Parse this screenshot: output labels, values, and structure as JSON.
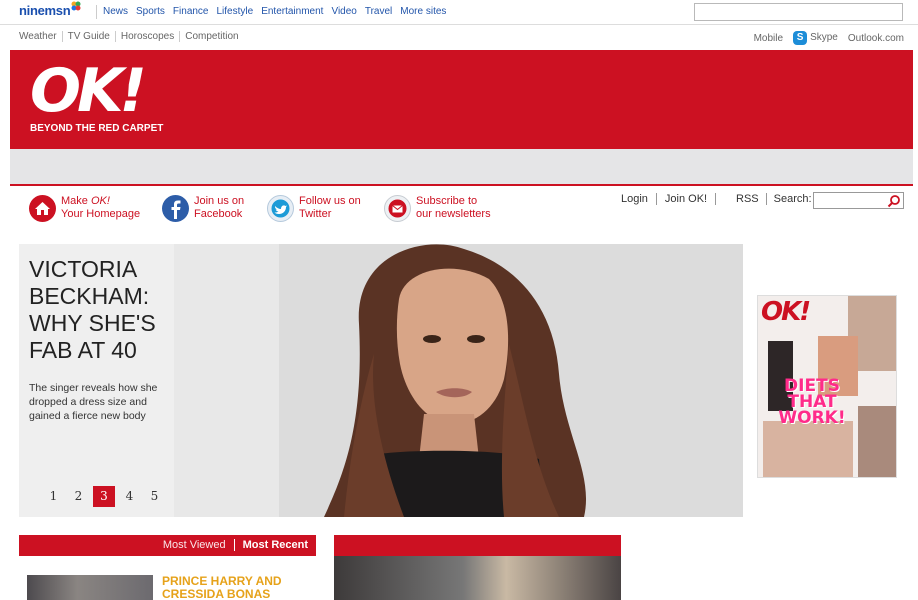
{
  "msn": {
    "logo": "ninemsn",
    "nav": [
      "News",
      "Sports",
      "Finance",
      "Lifestyle",
      "Entertainment",
      "Video",
      "Travel",
      "More sites"
    ],
    "search_placeholder": ""
  },
  "subnav": {
    "items": [
      "Weather",
      "TV Guide",
      "Horoscopes",
      "Competition"
    ],
    "right": {
      "mobile": "Mobile",
      "skype": "Skype",
      "outlook": "Outlook.com"
    }
  },
  "header": {
    "logo": "OK!",
    "tagline": "BEYOND THE RED CARPET"
  },
  "social": {
    "homepage": {
      "line1_a": "Make ",
      "line1_b": "OK!",
      "line2": "Your Homepage"
    },
    "facebook": {
      "line1": "Join us on",
      "line2": "Facebook"
    },
    "twitter": {
      "line1": "Follow us on",
      "line2": "Twitter"
    },
    "newsletter": {
      "line1": "Subscribe to",
      "line2": "our newsletters"
    }
  },
  "account": {
    "login": "Login",
    "join": "Join OK!",
    "rss": "RSS",
    "search_label": "Search:"
  },
  "hero": {
    "title": "VICTORIA BECKHAM: WHY SHE'S FAB AT 40",
    "description": "The singer reveals how she dropped a dress size and gained a fierce new body",
    "pages": [
      "1",
      "2",
      "3",
      "4",
      "5"
    ],
    "active_page": "3"
  },
  "magazine": {
    "logo": "OK!",
    "headline": "DIETS THAT WORK!"
  },
  "most_panel": {
    "tab_viewed": "Most Viewed",
    "tab_recent": "Most Recent",
    "headline": "PRINCE HARRY AND CRESSIDA BONAS"
  },
  "colors": {
    "brand_red": "#cc1122",
    "msn_blue": "#1a4fae",
    "headline_gold": "#e6a21a"
  }
}
